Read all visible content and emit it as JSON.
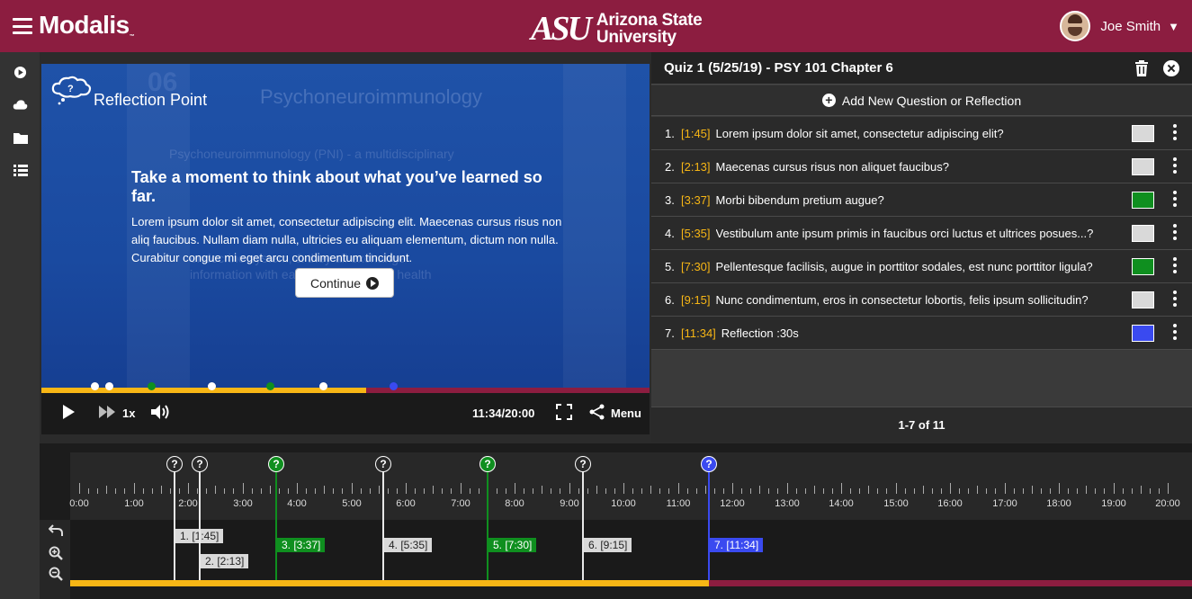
{
  "header": {
    "brand": "Modalis",
    "brand_tm": "TM",
    "university_mark": "ASU",
    "university_name_line1": "Arizona State",
    "university_name_line2": "University",
    "user_name": "Joe Smith",
    "accent_color": "#8c1d40"
  },
  "rail": {
    "icons": [
      "play-circle-icon",
      "cloud-icon",
      "folder-icon",
      "list-icon"
    ]
  },
  "video": {
    "ghost_title": "Psychoneuroimmunology",
    "ghost_number": "06",
    "ghost_lines": [
      "Psychoneuroimmunology (PNI) - a multidisciplinary",
      "endocrine system, & they all exchange",
      "information with each other & impact health"
    ],
    "reflection_title": "Reflection Point",
    "reflection_heading": "Take a moment to think about what you’ve learned so far.",
    "reflection_text": "Lorem ipsum dolor sit amet, consectetur adipiscing elit. Maecenas cursus risus non aliq faucibus. Nullam diam nulla, ultricies eu aliquam elementum, dictum non nulla. Curabitur congue mi eget arcu condimentum tincidunt.",
    "continue_label": "Continue",
    "progress_fraction": 0.5333,
    "speed_label": "1x",
    "time_label": "11:34/20:00",
    "menu_label": "Menu"
  },
  "panel": {
    "title": "Quiz 1 (5/25/19) - PSY 101 Chapter 6",
    "add_label": "Add New Question or Reflection",
    "pager_label": "1-7 of 11",
    "items": [
      {
        "num": "1.",
        "time": "[1:45]",
        "text": "Lorem ipsum dolor sit amet, consectetur adipiscing elit?",
        "color": "#d9d9d9"
      },
      {
        "num": "2.",
        "time": "[2:13]",
        "text": "Maecenas cursus risus non aliquet faucibus?",
        "color": "#d9d9d9"
      },
      {
        "num": "3.",
        "time": "[3:37]",
        "text": "Morbi bibendum pretium augue?",
        "color": "#0f8f1f"
      },
      {
        "num": "4.",
        "time": "[5:35]",
        "text": "Vestibulum ante ipsum primis in faucibus orci luctus et ultrices posues...?",
        "color": "#d9d9d9"
      },
      {
        "num": "5.",
        "time": "[7:30]",
        "text": "Pellentesque facilisis, augue in porttitor sodales, est nunc porttitor ligula?",
        "color": "#0f8f1f"
      },
      {
        "num": "6.",
        "time": "[9:15]",
        "text": "Nunc condimentum, eros in consectetur lobortis, felis ipsum sollicitudin?",
        "color": "#d9d9d9"
      },
      {
        "num": "7.",
        "time": "[11:34]",
        "text": "Reflection :30s",
        "color": "#3a4af0"
      }
    ]
  },
  "timeline": {
    "tick_labels": [
      "0:00",
      "1:00",
      "2:00",
      "3:00",
      "4:00",
      "5:00",
      "6:00",
      "7:00",
      "8:00",
      "9:00",
      "10:00",
      "11:00",
      "12:00",
      "13:00",
      "14:00",
      "15:00",
      "16:00",
      "17:00",
      "18:00",
      "19:00",
      "20:00"
    ],
    "markers": [
      {
        "label": "1. [1:45]",
        "seconds": 105,
        "color": "#d9d9d9",
        "text_color": "#222",
        "icon": "?"
      },
      {
        "label": "2. [2:13]",
        "seconds": 133,
        "color": "#d9d9d9",
        "text_color": "#222",
        "icon": "?"
      },
      {
        "label": "3. [3:37]",
        "seconds": 217,
        "color": "#0f8f1f",
        "text_color": "#fff",
        "icon": "?"
      },
      {
        "label": "4. [5:35]",
        "seconds": 335,
        "color": "#d9d9d9",
        "text_color": "#222",
        "icon": "?"
      },
      {
        "label": "5. [7:30]",
        "seconds": 450,
        "color": "#0f8f1f",
        "text_color": "#fff",
        "icon": "?"
      },
      {
        "label": "6. [9:15]",
        "seconds": 555,
        "color": "#d9d9d9",
        "text_color": "#222",
        "icon": "?"
      },
      {
        "label": "7. [11:34]",
        "seconds": 694,
        "color": "#3a4af0",
        "text_color": "#fff",
        "icon": "?"
      }
    ],
    "total_seconds": 1200,
    "played_color": "#f7b615",
    "remaining_color": "#8c1d40"
  }
}
